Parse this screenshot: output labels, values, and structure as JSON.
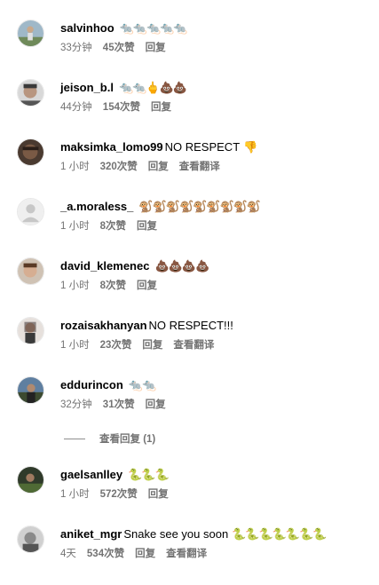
{
  "comments": [
    {
      "username": "salvinhoo",
      "text": "",
      "emoji": "🐀🐀🐀🐀🐀",
      "emoji_kind": "rat",
      "time": "33分钟",
      "likes": "45次赞",
      "reply": "回复",
      "translate": "",
      "avatar_icon": "person-photo-icon"
    },
    {
      "username": "jeison_b.l",
      "text": "",
      "emoji": "🐀🐀🖕💩💩",
      "emoji_kind": "mixed",
      "time": "44分钟",
      "likes": "154次赞",
      "reply": "回复",
      "translate": "",
      "avatar_icon": "person-photo-icon"
    },
    {
      "username": "maksimka_lomo99",
      "text": "NO RESPECT",
      "emoji": "👎",
      "emoji_kind": "thumb",
      "time": "1 小时",
      "likes": "320次赞",
      "reply": "回复",
      "translate": "查看翻译",
      "avatar_icon": "person-photo-icon"
    },
    {
      "username": "_a.moraless_",
      "text": "",
      "emoji": "🐒🐒🐒🐒🐒🐒🐒🐒🐒",
      "emoji_kind": "monkey",
      "time": "1 小时",
      "likes": "8次赞",
      "reply": "回复",
      "translate": "",
      "avatar_icon": "default-avatar-icon"
    },
    {
      "username": "david_klemenec",
      "text": "",
      "emoji": "💩💩💩💩",
      "emoji_kind": "poop",
      "time": "1 小时",
      "likes": "8次赞",
      "reply": "回复",
      "translate": "",
      "avatar_icon": "person-photo-icon"
    },
    {
      "username": "rozaisakhanyan",
      "text": "NO RESPECT!!!",
      "emoji": "",
      "emoji_kind": "",
      "time": "1 小时",
      "likes": "23次赞",
      "reply": "回复",
      "translate": "查看翻译",
      "avatar_icon": "person-photo-icon"
    },
    {
      "username": "eddurincon",
      "text": "",
      "emoji": "🐀🐀",
      "emoji_kind": "rat",
      "time": "32分钟",
      "likes": "31次赞",
      "reply": "回复",
      "translate": "",
      "avatar_icon": "person-photo-icon"
    },
    {
      "username": "gaelsanlley",
      "text": "",
      "emoji": "🐍🐍🐍",
      "emoji_kind": "snake",
      "time": "1 小时",
      "likes": "572次赞",
      "reply": "回复",
      "translate": "",
      "avatar_icon": "person-photo-icon"
    },
    {
      "username": "aniket_mgr",
      "text": "Snake see you soon",
      "emoji": "🐍🐍🐍🐍🐍🐍🐍",
      "emoji_kind": "snake",
      "time": "4天",
      "likes": "534次赞",
      "reply": "回复",
      "translate": "查看翻译",
      "avatar_icon": "person-photo-icon"
    }
  ],
  "view_replies": "查看回复 (1)",
  "colors": {
    "meta_text": "#737373",
    "username": "#000000",
    "background": "#ffffff"
  }
}
